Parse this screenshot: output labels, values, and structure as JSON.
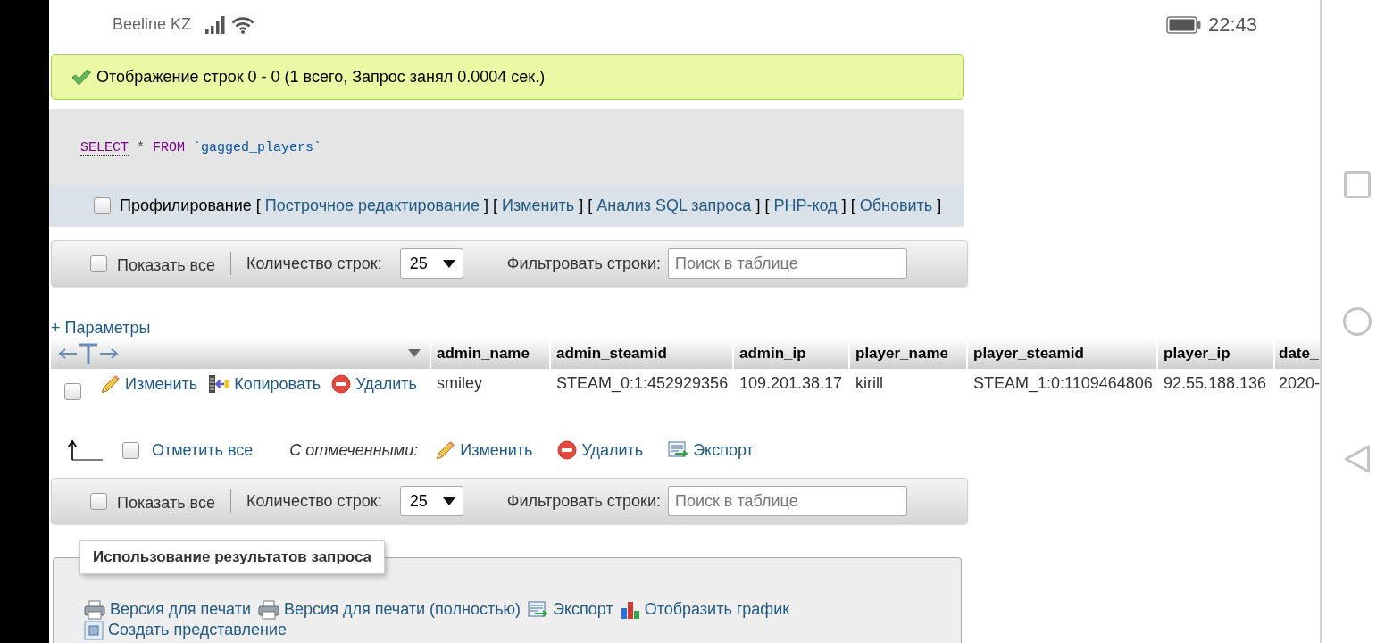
{
  "status_bar": {
    "carrier": "Beeline KZ",
    "time": "22:43"
  },
  "message": {
    "text": "Отображение строк 0 - 0 (1 всего, Запрос занял 0.0004 сек.)"
  },
  "sql": {
    "tokens": [
      {
        "kind": "keyword_link",
        "text": "SELECT"
      },
      {
        "kind": "operator",
        "text": "*"
      },
      {
        "kind": "keyword",
        "text": "FROM"
      },
      {
        "kind": "identifier",
        "text": "`gagged_players`"
      }
    ]
  },
  "profiling": {
    "checked": false,
    "parts": [
      {
        "kind": "label",
        "text": "Профилирование"
      },
      {
        "kind": "bracket",
        "text": "["
      },
      {
        "kind": "link",
        "text": "Построчное редактирование"
      },
      {
        "kind": "bracket",
        "text": "] ["
      },
      {
        "kind": "link",
        "text": "Изменить"
      },
      {
        "kind": "bracket",
        "text": "] ["
      },
      {
        "kind": "link",
        "text": "Анализ SQL запроса"
      },
      {
        "kind": "bracket",
        "text": "] ["
      },
      {
        "kind": "link",
        "text": "PHP-код"
      },
      {
        "kind": "bracket",
        "text": "] ["
      },
      {
        "kind": "link",
        "text": "Обновить"
      },
      {
        "kind": "bracket",
        "text": "]"
      }
    ]
  },
  "top_toolbar": {
    "show_all": {
      "label": "Показать все",
      "checked": false
    },
    "rows_label": "Количество строк:",
    "rows_value": "25",
    "filter_label": "Фильтровать строки:",
    "filter_placeholder": "Поиск в таблице"
  },
  "options_link": "+ Параметры",
  "table": {
    "columns": [
      "admin_name",
      "admin_steamid",
      "admin_ip",
      "player_name",
      "player_steamid",
      "player_ip",
      "date_"
    ],
    "rows": [
      {
        "checked": false,
        "actions": [
          {
            "kind": "edit",
            "label": "Изменить"
          },
          {
            "kind": "copy",
            "label": "Копировать"
          },
          {
            "kind": "delete",
            "label": "Удалить"
          }
        ],
        "cells": [
          "smiley",
          "STEAM_0:1:452929356",
          "109.201.38.17",
          "kirill",
          "STEAM_1:0:1109464806",
          "92.55.188.136",
          "2020-"
        ]
      }
    ]
  },
  "bulk_actions": {
    "check_all": {
      "label": "Отметить все",
      "checked": false
    },
    "with_selected": "С отмеченными:",
    "actions": [
      {
        "kind": "edit",
        "label": "Изменить"
      },
      {
        "kind": "delete",
        "label": "Удалить"
      },
      {
        "kind": "export",
        "label": "Экспорт"
      }
    ]
  },
  "bottom_toolbar": {
    "show_all": {
      "label": "Показать все",
      "checked": false
    },
    "rows_label": "Количество строк:",
    "rows_value": "25",
    "filter_label": "Фильтровать строки:",
    "filter_placeholder": "Поиск в таблице"
  },
  "query_results": {
    "legend": "Использование результатов запроса",
    "links": [
      {
        "kind": "print",
        "label": "Версия для печати"
      },
      {
        "kind": "print",
        "label": "Версия для печати (полностью)"
      },
      {
        "kind": "export",
        "label": "Экспорт"
      },
      {
        "kind": "chart",
        "label": "Отобразить график"
      },
      {
        "kind": "view",
        "label": "Создать представление"
      }
    ]
  }
}
